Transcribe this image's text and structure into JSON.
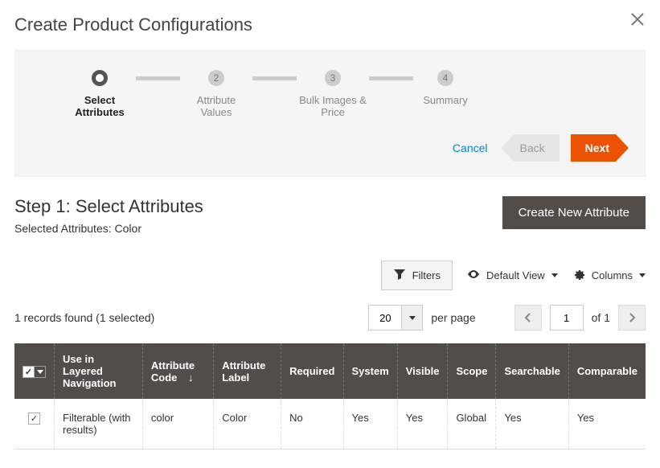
{
  "modal": {
    "title": "Create Product Configurations"
  },
  "stepper": {
    "steps": [
      {
        "label": "Select Attributes",
        "num": ""
      },
      {
        "label": "Attribute Values",
        "num": "2"
      },
      {
        "label": "Bulk Images & Price",
        "num": "3"
      },
      {
        "label": "Summary",
        "num": "4"
      }
    ]
  },
  "wizard": {
    "cancel": "Cancel",
    "back": "Back",
    "next": "Next"
  },
  "step": {
    "title": "Step 1: Select Attributes",
    "selected_label": "Selected Attributes:",
    "selected_text": "Color",
    "create_btn": "Create New Attribute"
  },
  "controls": {
    "filters": "Filters",
    "default_view": "Default View",
    "columns": "Columns"
  },
  "pager": {
    "records_text": "1 records found (1 selected)",
    "page_size": "20",
    "per_page": "per page",
    "current": "1",
    "of_total": "of 1"
  },
  "columns": {
    "use_in_layered": "Use in Layered Navigation",
    "attr_code": "Attribute Code",
    "attr_label": "Attribute Label",
    "required": "Required",
    "system": "System",
    "visible": "Visible",
    "scope": "Scope",
    "searchable": "Searchable",
    "comparable": "Comparable"
  },
  "rows": [
    {
      "checked": true,
      "use_in_layered": "Filterable (with results)",
      "attr_code": "color",
      "attr_label": "Color",
      "required": "No",
      "system": "Yes",
      "visible": "Yes",
      "scope": "Global",
      "searchable": "Yes",
      "comparable": "Yes"
    }
  ]
}
